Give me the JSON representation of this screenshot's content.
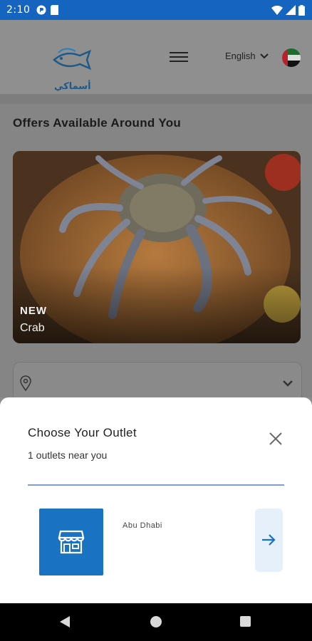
{
  "status_bar": {
    "time": "2:10"
  },
  "header": {
    "logo_text": "أسماكي",
    "language": "English"
  },
  "offers": {
    "title": "Offers Available Around You",
    "cards": [
      {
        "badge": "NEW",
        "name": "Crab"
      }
    ]
  },
  "outlet_sheet": {
    "title": "Choose Your Outlet",
    "subtitle": "1 outlets near you",
    "outlets": [
      {
        "name": "Abu Dhabi"
      }
    ]
  },
  "colors": {
    "status_bar": "#1565c0",
    "accent": "#1a73c2",
    "go_button_bg": "#e6f0fb",
    "overlay": "#8c8c8c"
  }
}
